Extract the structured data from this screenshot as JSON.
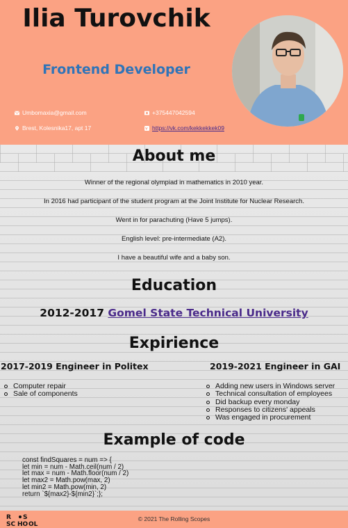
{
  "header": {
    "name": "Ilia Turovchik",
    "role": "Frontend Developer",
    "contacts": {
      "email": "Umbomaxia@gmail.com",
      "phone": "+375447042594",
      "address": "Brest, Kolesnika17, apt 17",
      "vk": "https://vk.com/kekkekkek09"
    },
    "photo_icon": "profile-photo"
  },
  "about": {
    "title": "About me",
    "lines": [
      "Winner of the regional olympiad in mathematics in 2010 year.",
      "In 2016 had participant of the student program at the Joint Institute for Nuclear Research.",
      "Went in for parachuting (Have 5 jumps).",
      "English level: pre-intermediate (A2).",
      "I have a beautiful wife and a baby son."
    ]
  },
  "education": {
    "title": "Education",
    "years": "2012-2017",
    "university": "Gomel State Technical University"
  },
  "experience": {
    "title": "Expirience",
    "jobs": [
      {
        "title": "2017-2019 Engineer in Politex",
        "items": [
          "Computer repair",
          "Sale of components"
        ]
      },
      {
        "title": "2019-2021 Engineer in GAI",
        "items": [
          "Adding new users in Windows server",
          "Technical consultation of employees",
          "Did backup every monday",
          "Responses to citizens' appeals",
          "Was engaged in procurement"
        ]
      }
    ]
  },
  "code_section": {
    "title": "Example of code",
    "lines": [
      "const findSquares = num => {",
      "let min = num - Math.ceil(num / 2)",
      "let max = num - Math.floor(num / 2)",
      "let max2 = Math.pow(max, 2)",
      "let min2 = Math.pow(min, 2)",
      "return `${max2}-${min2}`;};"
    ]
  },
  "footer": {
    "logo_text": [
      "R",
      "S",
      "SC",
      "HO",
      "OL"
    ],
    "copyright": "© 2021 The Rolling Scopes"
  },
  "colors": {
    "header_bg": "#fba283",
    "role": "#2f74b8",
    "link": "#4a2a8a"
  }
}
